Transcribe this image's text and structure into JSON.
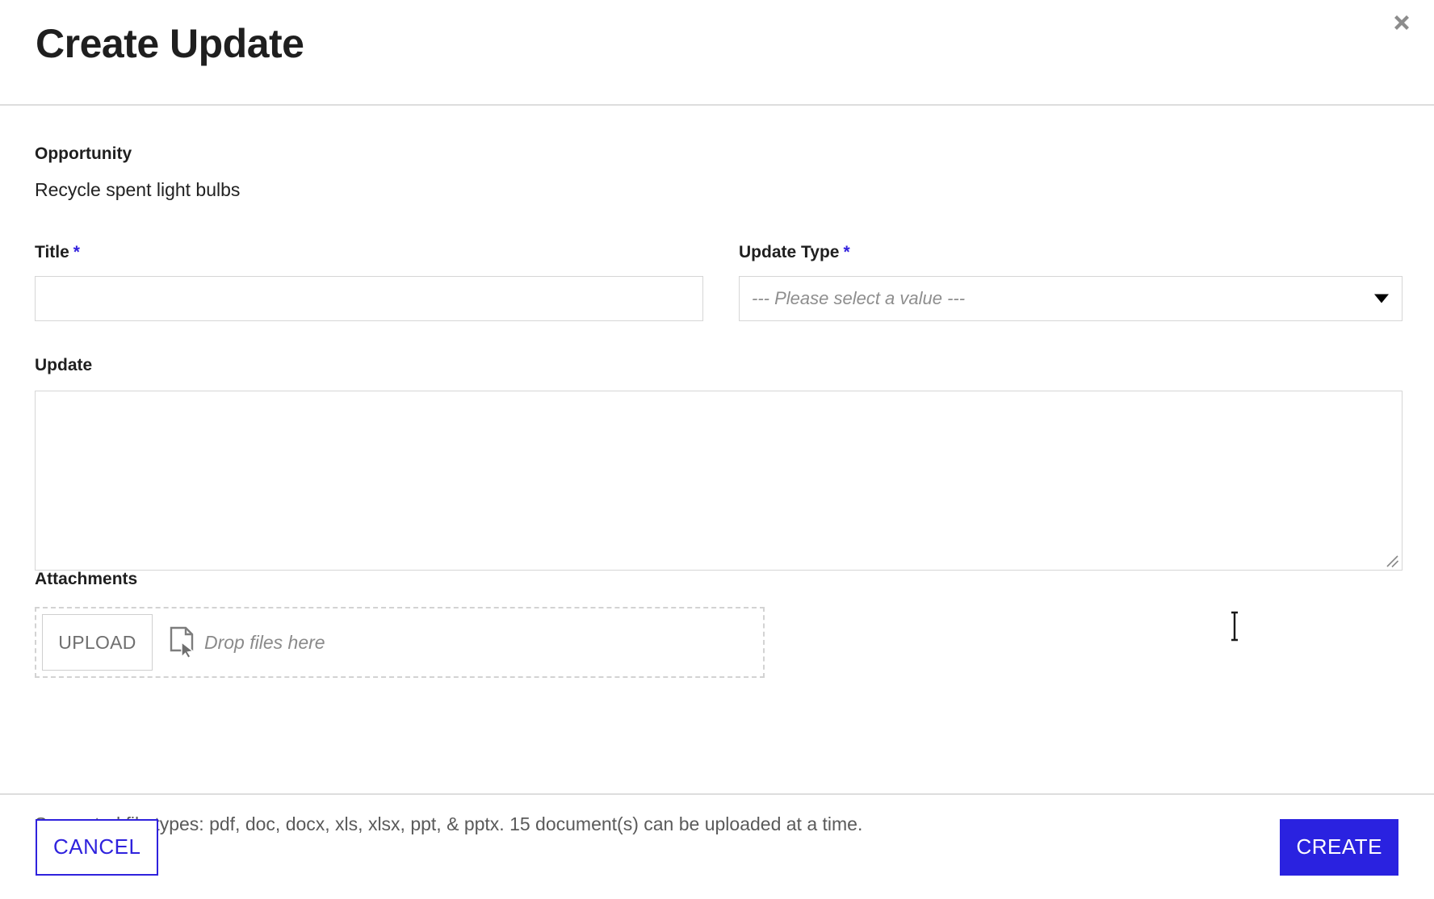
{
  "dialog": {
    "title": "Create Update",
    "close_icon": "close-icon"
  },
  "form": {
    "opportunity": {
      "label": "Opportunity",
      "value": "Recycle spent light bulbs"
    },
    "title_field": {
      "label": "Title",
      "required_marker": "*",
      "value": "",
      "placeholder": ""
    },
    "update_type_field": {
      "label": "Update Type",
      "required_marker": "*",
      "selected": "--- Please select a value ---",
      "dropdown_icon": "chevron-down-icon"
    },
    "update_field": {
      "label": "Update",
      "value": "",
      "placeholder": ""
    },
    "attachments": {
      "label": "Attachments",
      "upload_label": "UPLOAD",
      "drop_text": "Drop files here",
      "drop_icon": "document-cursor-icon",
      "supported_types": "Supported file types: pdf, doc, docx, xls, xlsx, ppt, & pptx. 15 document(s) can be uploaded at a time."
    }
  },
  "footer": {
    "cancel_label": "CANCEL",
    "create_label": "CREATE"
  },
  "colors": {
    "accent_blue": "#2a22e0",
    "required_star": "#3322dd",
    "border_gray": "#d6d6d6",
    "muted_text": "#8a8a8a"
  }
}
